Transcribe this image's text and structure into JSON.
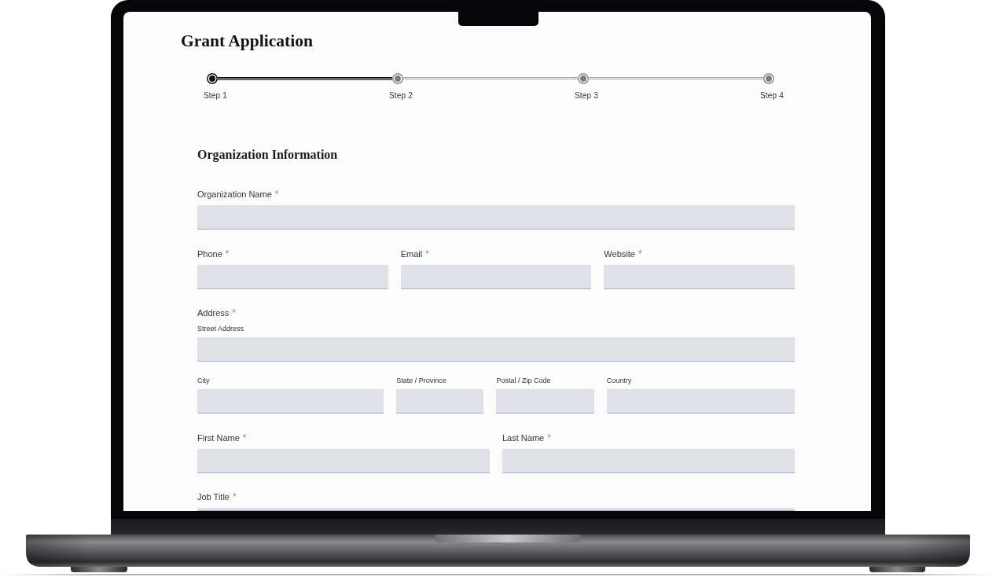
{
  "title": "Grant Application",
  "steps": [
    {
      "label": "Step 1",
      "selected": true
    },
    {
      "label": "Step 2",
      "selected": false
    },
    {
      "label": "Step 3",
      "selected": false
    },
    {
      "label": "Step 4",
      "selected": false
    }
  ],
  "form": {
    "heading": "Organization Information",
    "groups": [
      {
        "kind": "row",
        "fields": [
          {
            "label": "Organization Name",
            "required_mark": "*"
          }
        ]
      },
      {
        "kind": "row",
        "fields": [
          {
            "label": "Phone",
            "required_mark": "*"
          },
          {
            "label": "Email",
            "required_mark": "*"
          },
          {
            "label": "Website",
            "required_mark": "*"
          }
        ]
      },
      {
        "kind": "compound",
        "label": "Address",
        "required_mark": "*",
        "rows": [
          {
            "fields": [
              {
                "sublabel": "Street Address"
              }
            ]
          },
          {
            "fields": [
              {
                "sublabel": "City"
              },
              {
                "sublabel": "State / Province"
              },
              {
                "sublabel": "Postal / Zip Code"
              },
              {
                "sublabel": "Country"
              }
            ]
          }
        ]
      },
      {
        "kind": "row",
        "fields": [
          {
            "label": "First Name",
            "required_mark": "*"
          },
          {
            "label": "Last Name",
            "required_mark": "*"
          }
        ]
      },
      {
        "kind": "row",
        "fields": [
          {
            "label": "Job Title",
            "required_mark": "*"
          }
        ]
      }
    ]
  }
}
